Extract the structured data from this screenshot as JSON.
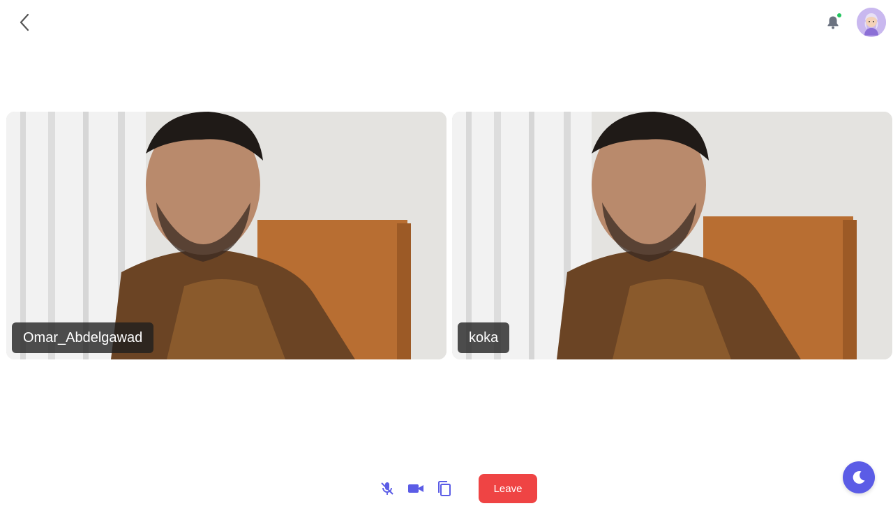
{
  "header": {
    "back_icon": "chevron-left-icon",
    "notification_icon": "bell-icon",
    "notification_badge_color": "#22c55e",
    "avatar_icon": "avatar"
  },
  "participants": [
    {
      "name": "Omar_Abdelgawad"
    },
    {
      "name": "koka"
    }
  ],
  "controls": {
    "mic_icon": "microphone-off-icon",
    "camera_icon": "video-camera-icon",
    "copy_icon": "copy-icon",
    "leave_label": "Leave",
    "leave_color": "#ef4444"
  },
  "theme_toggle": {
    "icon": "moon-icon",
    "color": "#5b5ce6"
  },
  "accent_color": "#5b5ce6"
}
